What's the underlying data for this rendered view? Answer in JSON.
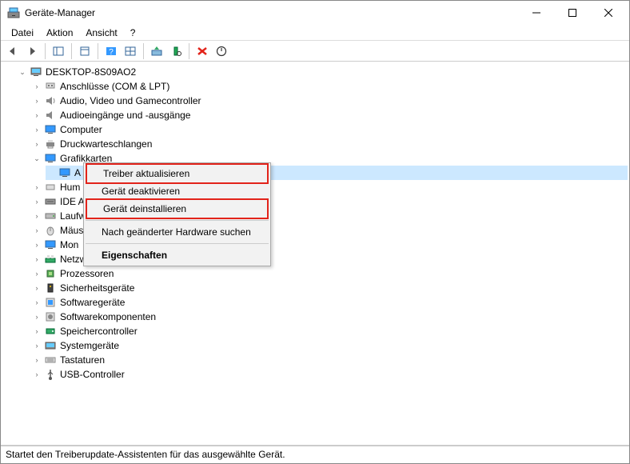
{
  "window": {
    "title": "Geräte-Manager"
  },
  "menubar": {
    "file": "Datei",
    "action": "Aktion",
    "view": "Ansicht",
    "help": "?"
  },
  "tree": {
    "root": "DESKTOP-8S09AO2",
    "items": [
      {
        "label": "Anschlüsse (COM & LPT)"
      },
      {
        "label": "Audio, Video und Gamecontroller"
      },
      {
        "label": "Audioeingänge und -ausgänge"
      },
      {
        "label": "Computer"
      },
      {
        "label": "Druckwarteschlangen"
      },
      {
        "label": "Grafikkarten",
        "expanded": true,
        "children": [
          {
            "label": "A"
          }
        ]
      },
      {
        "label": "Hum"
      },
      {
        "label": "IDE A"
      },
      {
        "label": "Laufw"
      },
      {
        "label": "Mäus"
      },
      {
        "label": "Mon"
      },
      {
        "label": "Netzw"
      },
      {
        "label": "Prozessoren"
      },
      {
        "label": "Sicherheitsgeräte"
      },
      {
        "label": "Softwaregeräte"
      },
      {
        "label": "Softwarekomponenten"
      },
      {
        "label": "Speichercontroller"
      },
      {
        "label": "Systemgeräte"
      },
      {
        "label": "Tastaturen"
      },
      {
        "label": "USB-Controller"
      }
    ]
  },
  "context_menu": {
    "update_driver": "Treiber aktualisieren",
    "disable_device": "Gerät deaktivieren",
    "uninstall_device": "Gerät deinstallieren",
    "scan_hardware": "Nach geänderter Hardware suchen",
    "properties": "Eigenschaften"
  },
  "status": "Startet den Treiberupdate-Assistenten für das ausgewählte Gerät."
}
